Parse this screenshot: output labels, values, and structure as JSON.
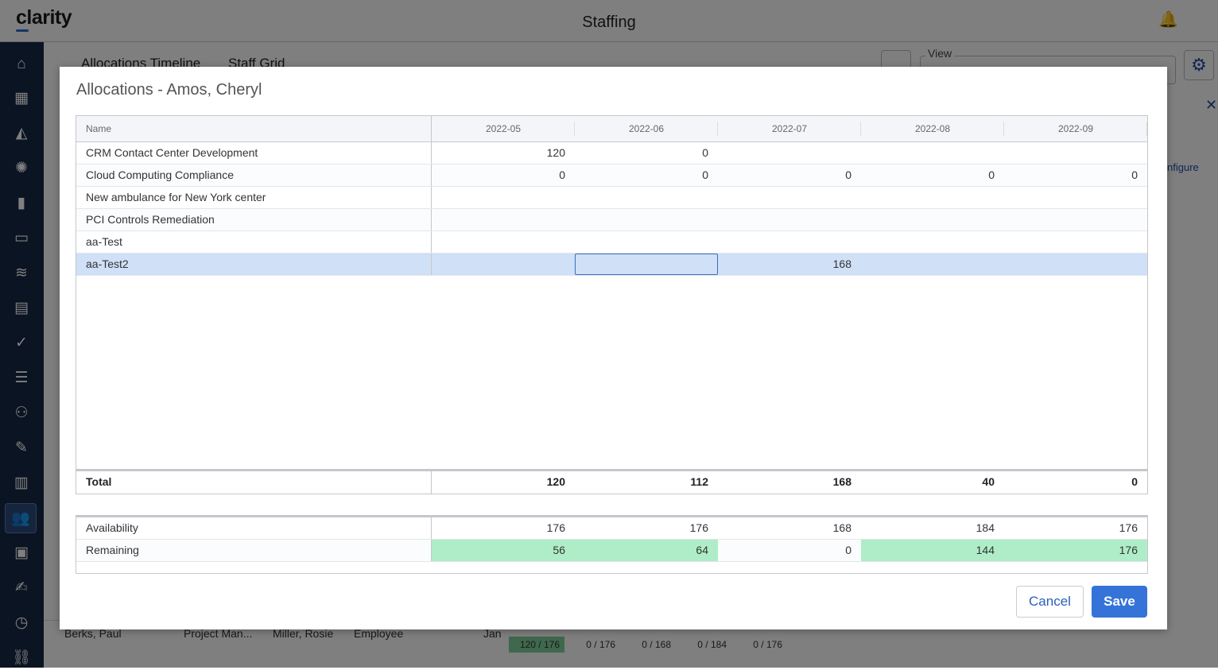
{
  "app": {
    "logo": "clarity",
    "title": "Staffing"
  },
  "background": {
    "tabs": [
      "Allocations Timeline",
      "Staff Grid"
    ],
    "view_label": "View",
    "configure_link": "nfigure",
    "row": {
      "name": "Berks, Paul",
      "role": "Project Man...",
      "manager": "Miller, Rosie",
      "type": "Employee",
      "start": "Jan",
      "allocations": [
        "120 / 176",
        "0 / 176",
        "0 / 168",
        "0 / 184",
        "0 / 176"
      ]
    }
  },
  "modal": {
    "title": "Allocations - Amos, Cheryl",
    "columns": [
      "Name",
      "2022-05",
      "2022-06",
      "2022-07",
      "2022-08",
      "2022-09"
    ],
    "rows": [
      {
        "name": "CRM Contact Center Development",
        "values": [
          "120",
          "0",
          "",
          "",
          ""
        ]
      },
      {
        "name": "Cloud Computing Compliance",
        "values": [
          "0",
          "0",
          "0",
          "0",
          "0"
        ]
      },
      {
        "name": "New ambulance for New York center",
        "values": [
          "",
          "",
          "",
          "",
          ""
        ]
      },
      {
        "name": "PCI Controls Remediation",
        "values": [
          "",
          "",
          "",
          "",
          ""
        ]
      },
      {
        "name": "aa-Test",
        "values": [
          "",
          "",
          "",
          "",
          ""
        ]
      },
      {
        "name": "aa-Test2",
        "values": [
          "",
          "",
          "168",
          "",
          ""
        ],
        "selected": true,
        "editing_column": 1
      }
    ],
    "total": {
      "label": "Total",
      "values": [
        "120",
        "112",
        "168",
        "40",
        "0"
      ]
    },
    "availability": {
      "label": "Availability",
      "values": [
        "176",
        "176",
        "168",
        "184",
        "176"
      ]
    },
    "remaining": {
      "label": "Remaining",
      "values": [
        "56",
        "64",
        "0",
        "144",
        "176"
      ],
      "positive": [
        true,
        true,
        false,
        true,
        true
      ]
    },
    "buttons": {
      "cancel": "Cancel",
      "save": "Save"
    },
    "colors": {
      "remaining_positive": "#aeedc7",
      "selected_row": "#cfe0f7",
      "save": "#3573d8"
    }
  }
}
